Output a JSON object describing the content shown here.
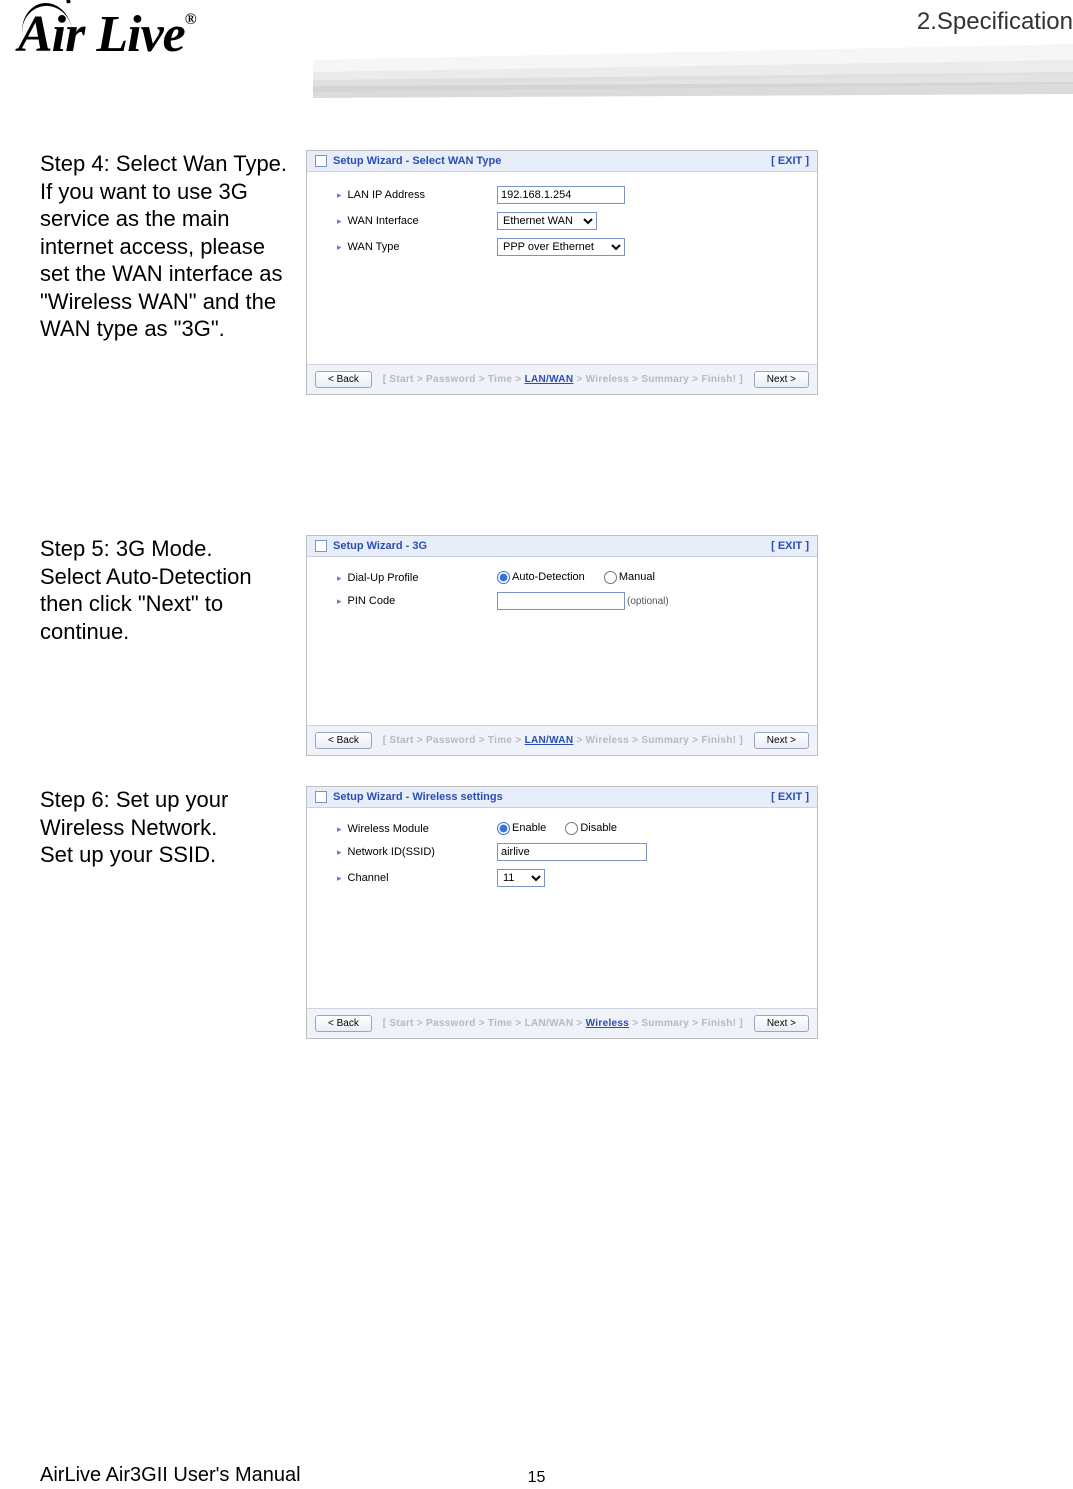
{
  "header": {
    "section_label": "2.Specification",
    "logo_text": "Air Live",
    "logo_reg": "®"
  },
  "steps": [
    {
      "heading": "Step 4: Select Wan Type.",
      "body": "If you want to use 3G service as the main internet access, please set the WAN interface as \"Wireless WAN\" and the WAN type as \"3G\".",
      "wizard": {
        "title": "Setup Wizard - Select WAN Type",
        "exit": "[ EXIT ]",
        "fields": [
          {
            "label": "LAN IP Address",
            "type": "text",
            "value": "192.168.1.254"
          },
          {
            "label": "WAN Interface",
            "type": "select",
            "value": "Ethernet WAN"
          },
          {
            "label": "WAN Type",
            "type": "select",
            "value": "PPP over Ethernet"
          }
        ],
        "back": "< Back",
        "next": "Next >",
        "crumb": {
          "prefix": "[ Start > Password > Time > ",
          "active": "LAN/WAN",
          "suffix": " > Wireless > Summary > Finish! ]"
        }
      }
    },
    {
      "heading": "Step 5: 3G Mode.",
      "body": "Select Auto-Detection then click \"Next\" to continue.",
      "wizard": {
        "title": "Setup Wizard - 3G",
        "exit": "[ EXIT ]",
        "fields": [
          {
            "label": "Dial-Up Profile",
            "type": "radio2",
            "opt1": "Auto-Detection",
            "opt2": "Manual",
            "checked": 0
          },
          {
            "label": "PIN Code",
            "type": "text_opt",
            "value": "",
            "note": "(optional)"
          }
        ],
        "back": "< Back",
        "next": "Next >",
        "crumb": {
          "prefix": "[ Start > Password > Time > ",
          "active": "LAN/WAN",
          "suffix": " > Wireless > Summary > Finish! ]"
        }
      }
    },
    {
      "heading": "Step 6: Set up your Wireless Network.",
      "body": "Set up your SSID.",
      "wizard": {
        "title": "Setup Wizard - Wireless settings",
        "exit": "[ EXIT ]",
        "fields": [
          {
            "label": "Wireless Module",
            "type": "radio2",
            "opt1": "Enable",
            "opt2": "Disable",
            "checked": 0
          },
          {
            "label": "Network ID(SSID)",
            "type": "text",
            "value": "airlive",
            "wide": true
          },
          {
            "label": "Channel",
            "type": "select",
            "value": "11"
          }
        ],
        "back": "< Back",
        "next": "Next >",
        "crumb": {
          "prefix": "[ Start > Password > Time > LAN/WAN > ",
          "active": "Wireless",
          "suffix": " > Summary > Finish! ]"
        }
      }
    }
  ],
  "footer": {
    "manual": "AirLive Air3GII User's Manual",
    "page": "15"
  }
}
